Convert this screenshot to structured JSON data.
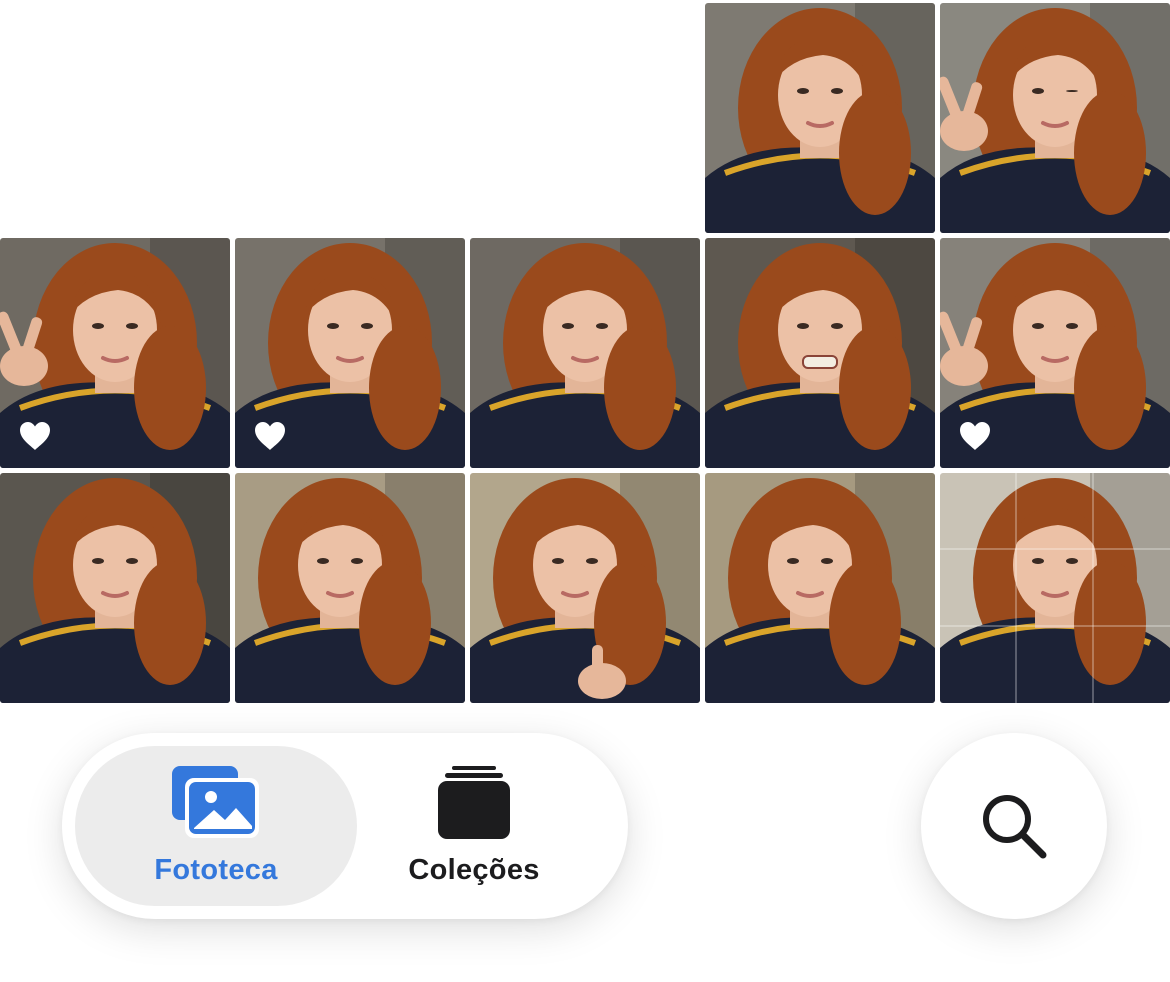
{
  "photos": [
    {
      "id": 1,
      "favorite": false,
      "pose": "neutral",
      "bg": "#7e7a72"
    },
    {
      "id": 2,
      "favorite": false,
      "pose": "peace-wink",
      "bg": "#8a8880"
    },
    {
      "id": 3,
      "favorite": true,
      "pose": "peace",
      "bg": "#6f6a62"
    },
    {
      "id": 4,
      "favorite": true,
      "pose": "smile",
      "bg": "#77726a"
    },
    {
      "id": 5,
      "favorite": false,
      "pose": "smile",
      "bg": "#6e6962"
    },
    {
      "id": 6,
      "favorite": false,
      "pose": "grimace",
      "bg": "#5e5850"
    },
    {
      "id": 7,
      "favorite": true,
      "pose": "peace",
      "bg": "#86827a"
    },
    {
      "id": 8,
      "favorite": false,
      "pose": "neutral",
      "bg": "#5a564f"
    },
    {
      "id": 9,
      "favorite": false,
      "pose": "tilt",
      "bg": "#a89c84"
    },
    {
      "id": 10,
      "favorite": false,
      "pose": "thumbs-up",
      "bg": "#b2a68c"
    },
    {
      "id": 11,
      "favorite": false,
      "pose": "tilt",
      "bg": "#a69a80"
    },
    {
      "id": 12,
      "favorite": false,
      "pose": "edit-grid",
      "bg": "#c9c3b6"
    }
  ],
  "tabs": [
    {
      "label": "Fototeca",
      "icon": "photo-library-icon",
      "active": true
    },
    {
      "label": "Coleções",
      "icon": "collections-stack-icon",
      "active": false
    }
  ],
  "search": {
    "icon": "search-icon"
  },
  "colors": {
    "accent": "#3478dc",
    "favorite_heart": "#ffffff",
    "shirt": "#1c2236",
    "shirt_trim": "#d9a42a",
    "hair": "#9a4a1c"
  }
}
